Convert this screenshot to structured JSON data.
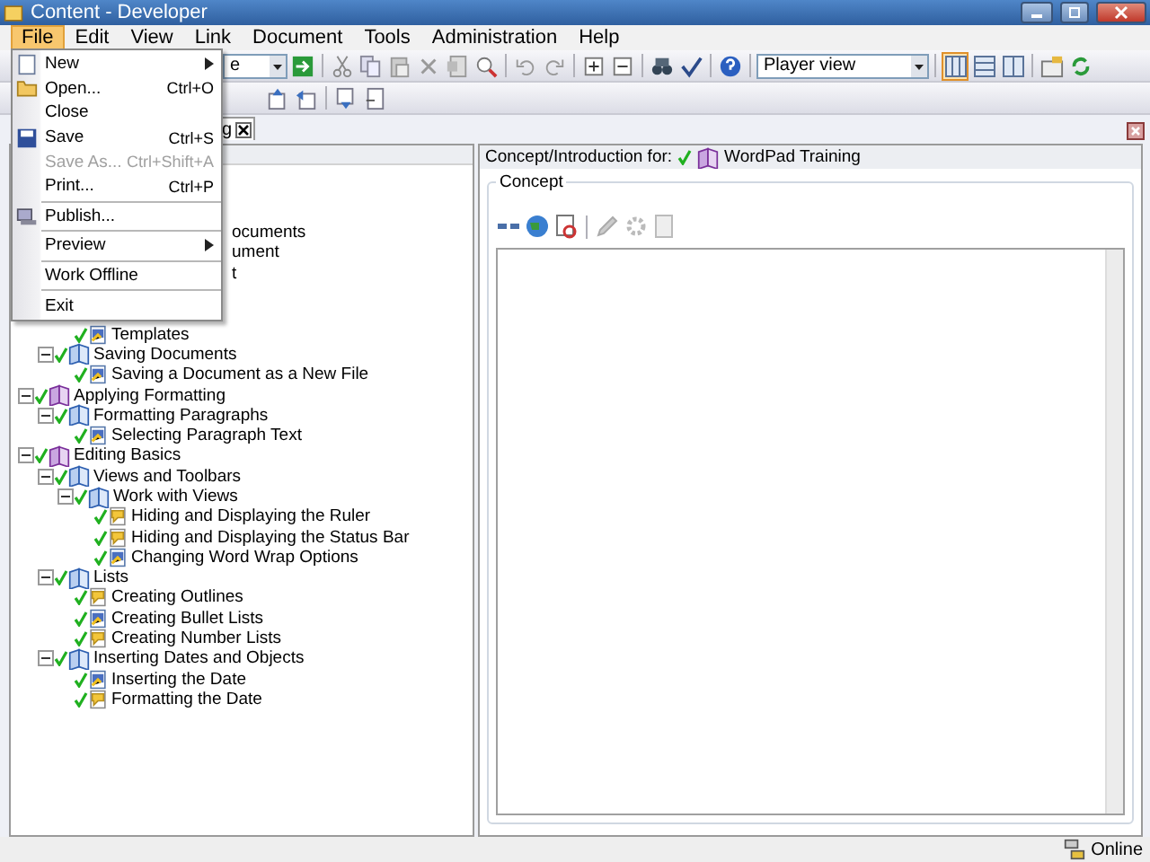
{
  "window": {
    "title": "Content - Developer"
  },
  "menubar": [
    {
      "label": "File",
      "selected": true
    },
    {
      "label": "Edit",
      "selected": false
    },
    {
      "label": "View",
      "selected": false
    },
    {
      "label": "Link",
      "selected": false
    },
    {
      "label": "Document",
      "selected": false
    },
    {
      "label": "Tools",
      "selected": false
    },
    {
      "label": "Administration",
      "selected": false
    },
    {
      "label": "Help",
      "selected": false
    }
  ],
  "toolbar": {
    "combo_value": "e",
    "view_select": "Player view",
    "layouts": [
      {
        "selected": true
      },
      {
        "selected": false
      },
      {
        "selected": false
      }
    ]
  },
  "doc_tab": {
    "label": "g"
  },
  "file_menu": [
    {
      "kind": "item",
      "label": "New",
      "submenu": true,
      "disabled": false
    },
    {
      "kind": "item",
      "label": "Open...",
      "shortcut": "Ctrl+O",
      "disabled": false
    },
    {
      "kind": "item",
      "label": "Close",
      "disabled": false
    },
    {
      "kind": "item",
      "label": "Save",
      "shortcut": "Ctrl+S",
      "disabled": false
    },
    {
      "kind": "item",
      "label": "Save As...",
      "shortcut": "Ctrl+Shift+A",
      "disabled": true
    },
    {
      "kind": "item",
      "label": "Print...",
      "shortcut": "Ctrl+P",
      "disabled": false
    },
    {
      "kind": "separator"
    },
    {
      "kind": "item",
      "label": "Publish...",
      "disabled": false
    },
    {
      "kind": "separator"
    },
    {
      "kind": "item",
      "label": "Preview",
      "submenu": true,
      "disabled": false
    },
    {
      "kind": "separator"
    },
    {
      "kind": "item",
      "label": "Work Offline",
      "disabled": false
    },
    {
      "kind": "separator"
    },
    {
      "kind": "item",
      "label": "Exit",
      "disabled": false
    }
  ],
  "tree": {
    "partial_rows": [
      "ocuments",
      "ument",
      "t"
    ],
    "nodes": [
      {
        "children": [
          {
            "children": [
              {
                "label": "Templates",
                "kind": "page",
                "checked": true
              }
            ]
          },
          {
            "label": "Saving Documents",
            "kind": "section",
            "checked": true,
            "expanded": true,
            "children": [
              {
                "label": "Saving a Document as a New File",
                "kind": "page",
                "checked": true
              }
            ]
          }
        ]
      },
      {
        "label": "Applying Formatting",
        "kind": "module",
        "checked": true,
        "expanded": true,
        "children": [
          {
            "label": "Formatting Paragraphs",
            "kind": "section",
            "checked": true,
            "expanded": true,
            "children": [
              {
                "label": "Selecting Paragraph Text",
                "kind": "page",
                "checked": true
              }
            ]
          }
        ]
      },
      {
        "label": "Editing Basics",
        "kind": "module",
        "checked": true,
        "expanded": true,
        "children": [
          {
            "label": "Views and Toolbars",
            "kind": "section",
            "checked": true,
            "expanded": true,
            "children": [
              {
                "label": "Work with Views",
                "kind": "section",
                "checked": true,
                "expanded": true,
                "children": [
                  {
                    "label": "Hiding and Displaying the Ruler",
                    "kind": "note",
                    "checked": true
                  },
                  {
                    "label": "Hiding and Displaying the Status Bar",
                    "kind": "note",
                    "checked": true
                  },
                  {
                    "label": "Changing Word Wrap Options",
                    "kind": "page",
                    "checked": true
                  }
                ]
              }
            ]
          },
          {
            "label": "Lists",
            "kind": "section",
            "checked": true,
            "expanded": true,
            "children": [
              {
                "label": "Creating Outlines",
                "kind": "note",
                "checked": true
              },
              {
                "label": "Creating Bullet Lists",
                "kind": "page",
                "checked": true
              },
              {
                "label": "Creating Number Lists",
                "kind": "note",
                "checked": true
              }
            ]
          },
          {
            "label": "Inserting Dates and Objects",
            "kind": "section",
            "checked": true,
            "expanded": true,
            "children": [
              {
                "label": "Inserting the Date",
                "kind": "page",
                "checked": true
              },
              {
                "label": "Formatting the Date",
                "kind": "note",
                "checked": true
              }
            ]
          }
        ]
      }
    ]
  },
  "editor": {
    "header_label": "Concept/Introduction for:",
    "module": "WordPad Training",
    "module_checked": true,
    "group_label": "Concept"
  },
  "status_bar": {
    "connection": "Online"
  }
}
